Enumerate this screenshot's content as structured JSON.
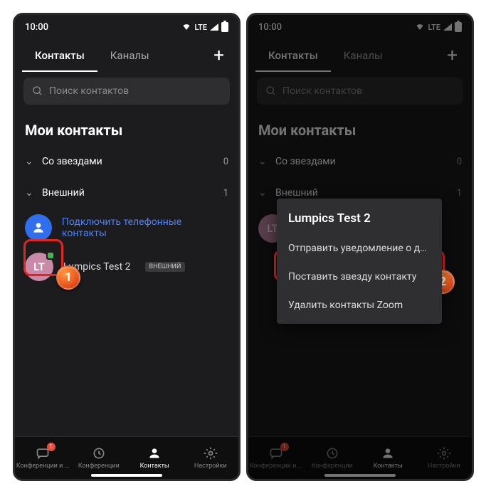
{
  "status": {
    "time": "10:00",
    "net": "LTE"
  },
  "tabs": {
    "contacts": "Контакты",
    "channels": "Каналы"
  },
  "search": {
    "placeholder": "Поиск контактов"
  },
  "section": "Мои контакты",
  "groups": {
    "starred": {
      "label": "Со звездами",
      "count": "0"
    },
    "external": {
      "label": "Внешний",
      "count": "1"
    }
  },
  "connect": "Подключить телефонные контакты",
  "contact": {
    "initials": "LT",
    "name": "Lumpics Test 2",
    "badge": "ВНЕШНИЙ"
  },
  "nav": {
    "chat": "Конференции и ...",
    "meet": "Конференции",
    "contacts": "Контакты",
    "settings": "Настройки",
    "badge": "1"
  },
  "menu": {
    "title": "Lumpics Test 2",
    "notify": "Отправить уведомление о дос...",
    "star": "Поставить звезду контакту",
    "remove": "Удалить контакты Zoom"
  },
  "callouts": {
    "one": "1",
    "two": "2"
  }
}
